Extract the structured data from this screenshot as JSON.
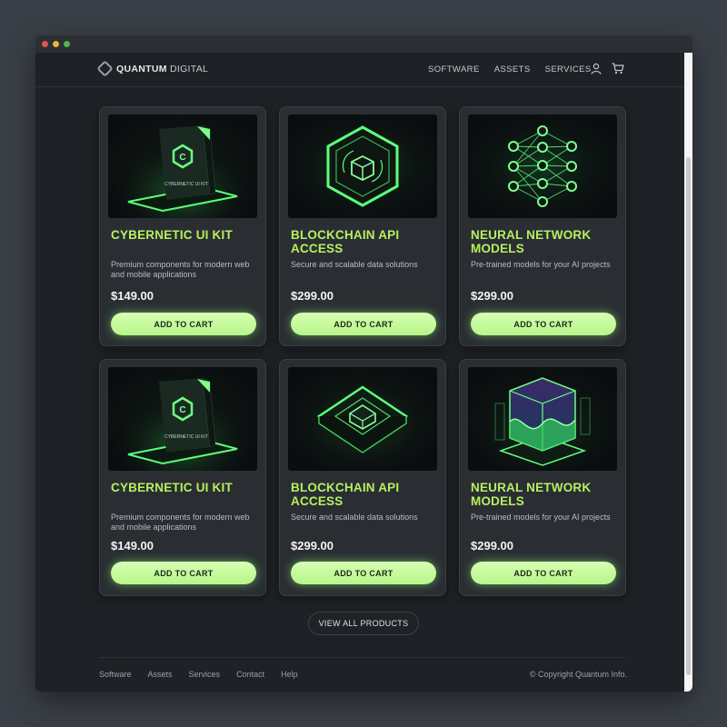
{
  "brand": {
    "name_bold": "QUANTUM",
    "name_rest": " DIGITAL",
    "logo_icon": "hexagon-logo-icon"
  },
  "nav": {
    "links": [
      "SOFTWARE",
      "ASSETS",
      "SERVICES"
    ],
    "icons": [
      "user-icon",
      "cart-icon"
    ]
  },
  "products": [
    {
      "title": "CYBERNETIC UI KIT",
      "desc": "Premium components for modern web and mobile applications",
      "price": "$149.00",
      "cta": "ADD TO CART",
      "image": "software-box-image"
    },
    {
      "title": "BLOCKCHAIN API ACCESS",
      "desc": "Secure and scalable data solutions",
      "price": "$299.00",
      "cta": "ADD TO CART",
      "image": "hexagon-cube-image"
    },
    {
      "title": "NEURAL NETWORK MODELS",
      "desc": "Pre-trained models for your AI projects",
      "price": "$299.00",
      "cta": "ADD TO CART",
      "image": "neural-network-image"
    },
    {
      "title": "CYBERNETIC UI KIT",
      "desc": "Premium components for modern web and mobile applications",
      "price": "$149.00",
      "cta": "ADD TO CART",
      "image": "software-box-image"
    },
    {
      "title": "BLOCKCHAIN API ACCESS",
      "desc": "Secure and scalable data solutions",
      "price": "$299.00",
      "cta": "ADD TO CART",
      "image": "isometric-chip-image"
    },
    {
      "title": "NEURAL NETWORK MODELS",
      "desc": "Pre-trained models for your AI projects",
      "price": "$299.00",
      "cta": "ADD TO CART",
      "image": "data-cube-image"
    }
  ],
  "view_all_label": "VIEW ALL PRODUCTS",
  "footer": {
    "links": [
      "Software",
      "Assets",
      "Services",
      "Contact",
      "Help"
    ],
    "copyright": "© Copyright Quantum Info."
  },
  "box_label": "CYBERNETIC UI KIT",
  "colors": {
    "accent": "#b7ef5f",
    "button": "#c8fa9e",
    "background": "#1e2125",
    "card": "#2a2e33"
  }
}
